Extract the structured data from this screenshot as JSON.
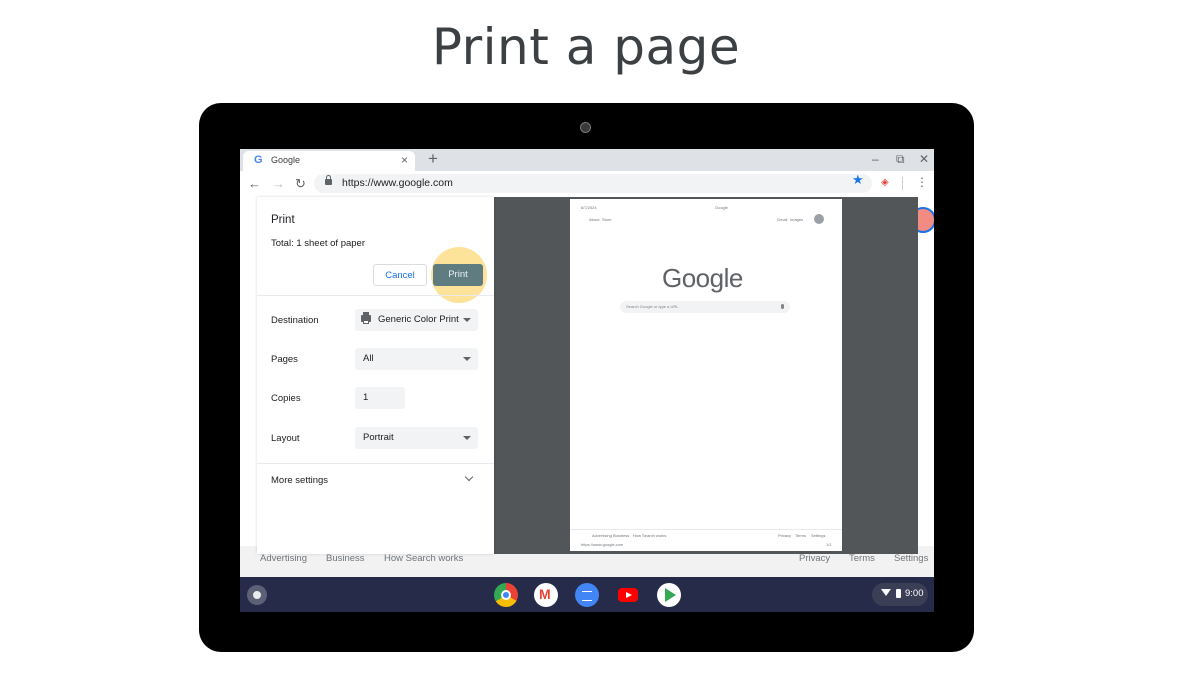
{
  "heading": "Print a page",
  "browser": {
    "tab_icon": "G",
    "tab_title": "Google",
    "tab_close": "×",
    "new_tab": "+",
    "url": "https://www.google.com",
    "min": "–",
    "restore": "⧉",
    "close": "✕"
  },
  "print_dialog": {
    "title": "Print",
    "total": "Total: 1 sheet of paper",
    "cancel_label": "Cancel",
    "print_label": "Print",
    "destination_label": "Destination",
    "destination_value": "Generic Color Print",
    "pages_label": "Pages",
    "pages_value": "All",
    "copies_label": "Copies",
    "copies_value": "1",
    "layout_label": "Layout",
    "layout_value": "Portrait",
    "more_settings": "More settings"
  },
  "preview": {
    "date": "6/7/2024",
    "header_title": "Google",
    "about": "About",
    "store": "Store",
    "gmail": "Gmail",
    "images": "Images",
    "logo": "Google",
    "search_placeholder": "Search Google or type a URL",
    "footer_left": [
      "Advertising",
      "Business",
      "How Search works"
    ],
    "footer_right": [
      "Privacy",
      "Terms",
      "Settings"
    ],
    "url_footer": "https://www.google.com",
    "page_number": "1/1"
  },
  "page_footer": {
    "advertising": "Advertising",
    "business": "Business",
    "how_search_works": "How Search works",
    "privacy": "Privacy",
    "terms": "Terms",
    "settings": "Settings"
  },
  "shelf": {
    "time": "9:00"
  },
  "colors": {
    "print_button": "#5f7d80",
    "highlight": "#fde293",
    "shelf": "#262b4a"
  }
}
